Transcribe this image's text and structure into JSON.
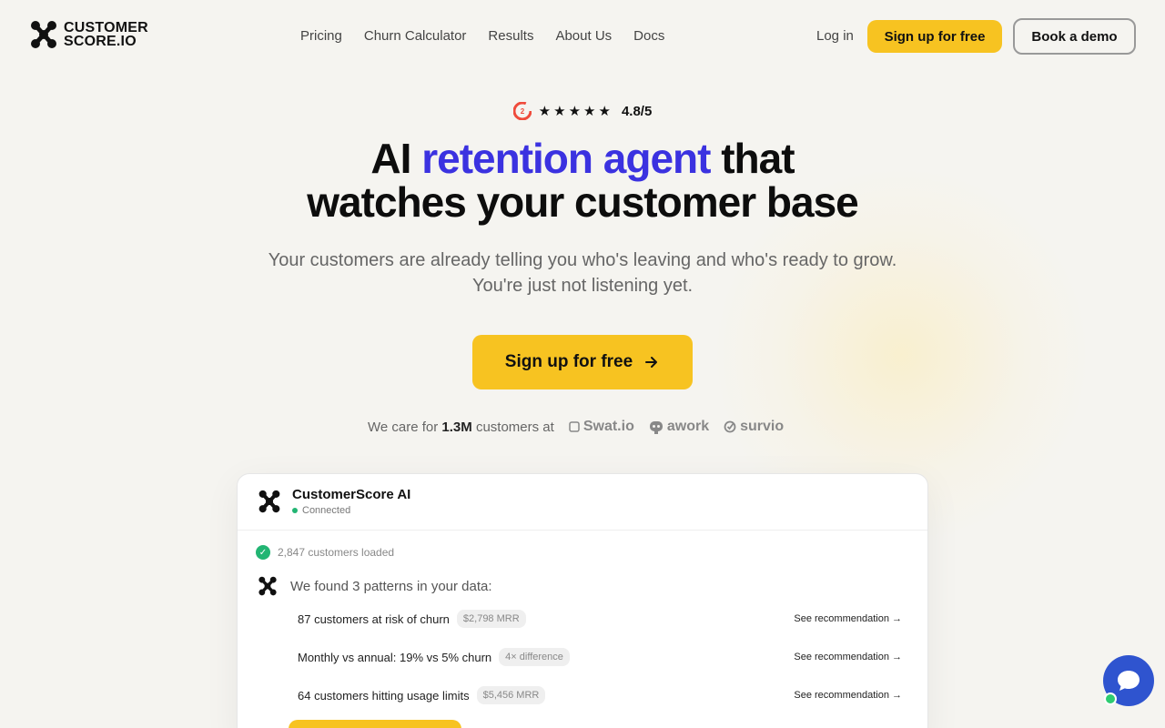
{
  "colors": {
    "accent": "#3b32e0",
    "cta": "#f7c321",
    "success": "#22b573",
    "chat": "#2f54cf"
  },
  "nav": {
    "logo_line1": "CUSTOMER",
    "logo_line2": "SCORE.IO",
    "links": [
      "Pricing",
      "Churn Calculator",
      "Results",
      "About Us",
      "Docs"
    ],
    "login": "Log in",
    "signup": "Sign up for free",
    "demo": "Book a demo"
  },
  "hero": {
    "rating_icon": "g2-icon",
    "stars": 5,
    "rating": "4.8/5",
    "headline_pre": "AI ",
    "headline_highlight": "retention agent",
    "headline_post": " that",
    "headline_line2": "watches your customer base",
    "subhead_line1": "Your customers are already telling you who's leaving and who's ready to grow.",
    "subhead_line2": "You're just not listening yet.",
    "cta": "Sign up for free"
  },
  "trust": {
    "prefix": "We care for",
    "count": "1.3M",
    "suffix": "customers at",
    "brands": [
      "Swat.io",
      "awork",
      "survio"
    ]
  },
  "card": {
    "title": "CustomerScore AI",
    "status": "Connected",
    "loaded": "2,847 customers loaded",
    "found": "We found 3 patterns in your data:",
    "patterns": [
      {
        "text": "87 customers at risk of churn",
        "badge": "$2,798 MRR",
        "link": "See recommendation →"
      },
      {
        "text": "Monthly vs annual: 19% vs 5% churn",
        "badge": "4× difference",
        "link": "See recommendation →"
      },
      {
        "text": "64 customers hitting usage limits",
        "badge": "$5,456 MRR",
        "link": "See recommendation →"
      }
    ]
  },
  "chat": {
    "icon": "chat-bubble-icon"
  }
}
